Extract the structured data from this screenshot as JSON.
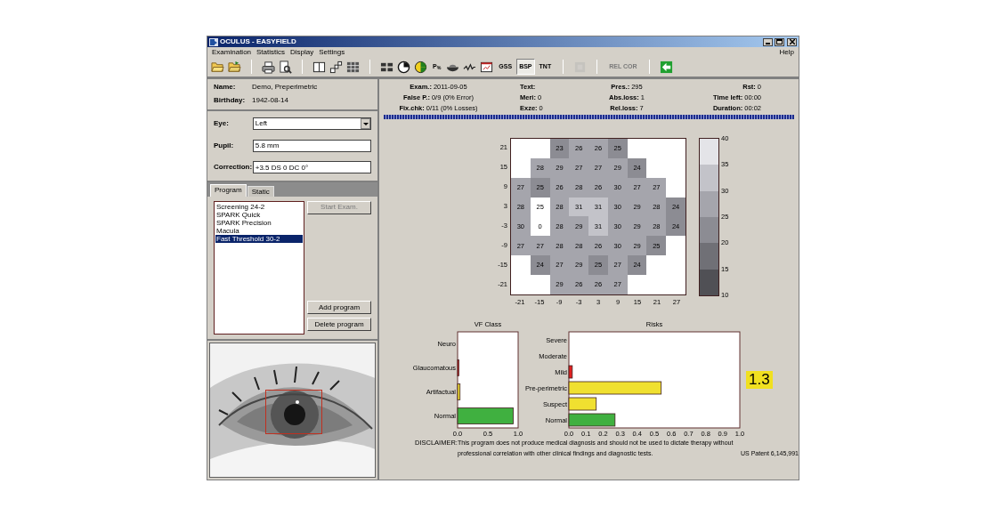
{
  "window": {
    "title": "OCULUS - EASYFIELD"
  },
  "menu": {
    "items": [
      "Examination",
      "Statistics",
      "Display",
      "Settings"
    ],
    "help": "Help"
  },
  "toolbar": [
    [
      {
        "kind": "icon",
        "disabled": false,
        "pressed": false
      },
      {
        "kind": "icon",
        "disabled": false,
        "pressed": false
      }
    ],
    [
      {
        "kind": "icon",
        "disabled": false,
        "pressed": false
      },
      {
        "kind": "icon",
        "disabled": false,
        "pressed": false
      }
    ],
    [
      {
        "kind": "icon",
        "disabled": false,
        "pressed": false
      },
      {
        "kind": "icon",
        "disabled": false,
        "pressed": false
      },
      {
        "kind": "icon",
        "disabled": false,
        "pressed": false
      }
    ],
    [
      {
        "kind": "icon",
        "disabled": false,
        "pressed": false
      },
      {
        "kind": "icon",
        "disabled": false,
        "pressed": false
      },
      {
        "kind": "icon",
        "disabled": false,
        "pressed": false
      },
      {
        "kind": "text",
        "label": "P$_{%}$",
        "disabled": false,
        "pressed": false
      },
      {
        "kind": "icon",
        "disabled": false,
        "pressed": false
      },
      {
        "kind": "icon",
        "disabled": false,
        "pressed": false
      },
      {
        "kind": "icon",
        "disabled": false,
        "pressed": false
      },
      {
        "kind": "text",
        "label": "GSS",
        "disabled": false,
        "pressed": false
      },
      {
        "kind": "text",
        "label": "BSP",
        "disabled": false,
        "pressed": true
      },
      {
        "kind": "text",
        "label": "TNT",
        "disabled": false,
        "pressed": false
      }
    ],
    [
      {
        "kind": "icon",
        "disabled": true,
        "pressed": false
      }
    ],
    [
      {
        "kind": "text",
        "label": "REL COR",
        "disabled": true,
        "pressed": false
      }
    ],
    [
      {
        "kind": "icon",
        "disabled": false,
        "pressed": false
      }
    ]
  ],
  "patient": [
    {
      "label": "Name:",
      "value": "Demo, Preperimetric"
    },
    {
      "label": "Birthday:",
      "value": "1942-08-14"
    }
  ],
  "settings": {
    "eye": {
      "label": "Eye:",
      "value": "Left"
    },
    "pupil": {
      "label": "Pupil:",
      "value": "5.8 mm"
    },
    "correction": {
      "label": "Correction:",
      "value": "+3.5 DS 0 DC 0°"
    }
  },
  "tabs": [
    {
      "label": "Program",
      "selected": true
    },
    {
      "label": "Static",
      "selected": false
    }
  ],
  "programs": [
    {
      "label": "Screening 24-2",
      "selected": false
    },
    {
      "label": "SPARK Quick",
      "selected": false
    },
    {
      "label": "SPARK Precision",
      "selected": false
    },
    {
      "label": "Macula",
      "selected": false
    },
    {
      "label": "Fast Threshold 30-2",
      "selected": true
    }
  ],
  "buttons": [
    {
      "label": "Start Exam.",
      "disabled": true
    },
    {
      "label": "Add program",
      "disabled": false
    },
    {
      "label": "Delete program",
      "disabled": false
    }
  ],
  "header": [
    [
      {
        "label": "Exam.:",
        "value": "2011-09-05"
      },
      {
        "label": "False P.:",
        "value": "0/9 (0% Error)"
      },
      {
        "label": "Fix.chk:",
        "value": "0/11 (0% Losses)"
      }
    ],
    [
      {
        "label": "Text:"
      },
      {
        "label": "Meri:",
        "value": "0"
      },
      {
        "label": "Exze:",
        "value": "0"
      }
    ],
    [
      {
        "label": "Pres.:",
        "value": "295"
      },
      {
        "label": "Abs.loss:",
        "value": "1"
      },
      {
        "label": "Rel.loss:",
        "value": "7"
      }
    ],
    [
      {
        "label": "Rst:",
        "value": "0"
      },
      {
        "label": "Time left:",
        "value": "00:00"
      },
      {
        "label": "Duration:",
        "value": "00:02"
      }
    ]
  ],
  "progress": {
    "level": 1
  },
  "threshold_map": {
    "y_labels": [
      "21",
      "15",
      "9",
      "3",
      "-3",
      "-9",
      "-15",
      "-21"
    ],
    "x_labels": [
      "-21",
      "-15",
      "-9",
      "-3",
      "3",
      "9",
      "15",
      "21",
      "27"
    ],
    "rows": [
      [
        null,
        null,
        {
          "value": "23",
          "color": "#8c8c93"
        },
        {
          "value": "26",
          "color": "#a5a5ac"
        },
        {
          "value": "26",
          "color": "#a5a5ac"
        },
        {
          "value": "25",
          "color": "#8c8c93"
        },
        null,
        null,
        null
      ],
      [
        null,
        {
          "value": "28",
          "color": "#a5a5ac"
        },
        {
          "value": "29",
          "color": "#a5a5ac"
        },
        {
          "value": "27",
          "color": "#a5a5ac"
        },
        {
          "value": "27",
          "color": "#a5a5ac"
        },
        {
          "value": "29",
          "color": "#a5a5ac"
        },
        {
          "value": "24",
          "color": "#8c8c93"
        },
        null,
        null
      ],
      [
        {
          "value": "27",
          "color": "#a5a5ac"
        },
        {
          "value": "25",
          "color": "#8c8c93"
        },
        {
          "value": "26",
          "color": "#a5a5ac"
        },
        {
          "value": "28",
          "color": "#a5a5ac"
        },
        {
          "value": "26",
          "color": "#a5a5ac"
        },
        {
          "value": "30",
          "color": "#a5a5ac"
        },
        {
          "value": "27",
          "color": "#a5a5ac"
        },
        {
          "value": "27",
          "color": "#a5a5ac"
        },
        null
      ],
      [
        {
          "value": "28",
          "color": "#a5a5ac"
        },
        {
          "value": "25",
          "color": "#ffffff"
        },
        {
          "value": "28",
          "color": "#a5a5ac"
        },
        {
          "value": "31",
          "color": "#c3c3c9"
        },
        {
          "value": "31",
          "color": "#c3c3c9"
        },
        {
          "value": "30",
          "color": "#a5a5ac"
        },
        {
          "value": "29",
          "color": "#a5a5ac"
        },
        {
          "value": "28",
          "color": "#a5a5ac"
        },
        {
          "value": "24",
          "color": "#8c8c93"
        }
      ],
      [
        {
          "value": "30",
          "color": "#a5a5ac"
        },
        {
          "value": "0",
          "color": "#ffffff"
        },
        {
          "value": "28",
          "color": "#a5a5ac"
        },
        {
          "value": "29",
          "color": "#a5a5ac"
        },
        {
          "value": "31",
          "color": "#c3c3c9"
        },
        {
          "value": "30",
          "color": "#a5a5ac"
        },
        {
          "value": "29",
          "color": "#a5a5ac"
        },
        {
          "value": "28",
          "color": "#a5a5ac"
        },
        {
          "value": "24",
          "color": "#8c8c93"
        }
      ],
      [
        {
          "value": "27",
          "color": "#a5a5ac"
        },
        {
          "value": "27",
          "color": "#a5a5ac"
        },
        {
          "value": "28",
          "color": "#a5a5ac"
        },
        {
          "value": "28",
          "color": "#a5a5ac"
        },
        {
          "value": "26",
          "color": "#a5a5ac"
        },
        {
          "value": "30",
          "color": "#a5a5ac"
        },
        {
          "value": "29",
          "color": "#a5a5ac"
        },
        {
          "value": "25",
          "color": "#8c8c93"
        },
        null
      ],
      [
        null,
        {
          "value": "24",
          "color": "#8c8c93"
        },
        {
          "value": "27",
          "color": "#a5a5ac"
        },
        {
          "value": "29",
          "color": "#a5a5ac"
        },
        {
          "value": "25",
          "color": "#8c8c93"
        },
        {
          "value": "27",
          "color": "#a5a5ac"
        },
        {
          "value": "24",
          "color": "#8c8c93"
        },
        null,
        null
      ],
      [
        null,
        null,
        {
          "value": "29",
          "color": "#a5a5ac"
        },
        {
          "value": "26",
          "color": "#a5a5ac"
        },
        {
          "value": "26",
          "color": "#a5a5ac"
        },
        {
          "value": "27",
          "color": "#a5a5ac"
        },
        null,
        null,
        null
      ]
    ]
  },
  "color_scale": {
    "ticks": [
      "40",
      "35",
      "30",
      "25",
      "20",
      "15",
      "10"
    ],
    "bands": [
      {
        "color": "#e4e4e8"
      },
      {
        "color": "#c3c3c9"
      },
      {
        "color": "#a5a5ac"
      },
      {
        "color": "#8c8c93"
      },
      {
        "color": "#707076"
      },
      {
        "color": "#505055"
      }
    ]
  },
  "vf_class": {
    "chart_data": {
      "type": "bar",
      "orientation": "horizontal",
      "title": "VF Class",
      "categories": [
        "Neuro",
        "Glaucomatous",
        "Artifactual",
        "Normal"
      ],
      "stacked": true,
      "xlim": [
        0,
        1
      ],
      "xticks": [
        {
          "value": 0,
          "label": "0.0"
        },
        {
          "value": 0.5,
          "label": "0.5"
        },
        {
          "value": 1,
          "label": "1.0"
        }
      ],
      "series": [
        {
          "color": "#e02020",
          "values": [
            null,
            0.02,
            null,
            null
          ]
        },
        {
          "color": "#f0e030",
          "values": [
            null,
            null,
            0.04,
            null
          ]
        },
        {
          "color": "#40b040",
          "values": [
            null,
            null,
            null,
            0.92
          ]
        }
      ]
    }
  },
  "risks": {
    "chart_data": {
      "type": "bar",
      "orientation": "horizontal",
      "title": "Risks",
      "categories": [
        "Severe",
        "Moderate",
        "Mild",
        "Pre-perimetric",
        "Suspect",
        "Normal"
      ],
      "stacked": true,
      "xlim": [
        0,
        1
      ],
      "xticks": [
        {
          "value": 0,
          "label": "0.0"
        },
        {
          "value": 0.1,
          "label": "0.1"
        },
        {
          "value": 0.2,
          "label": "0.2"
        },
        {
          "value": 0.3,
          "label": "0.3"
        },
        {
          "value": 0.4,
          "label": "0.4"
        },
        {
          "value": 0.5,
          "label": "0.5"
        },
        {
          "value": 0.6,
          "label": "0.6"
        },
        {
          "value": 0.7,
          "label": "0.7"
        },
        {
          "value": 0.8,
          "label": "0.8"
        },
        {
          "value": 0.9,
          "label": "0.9"
        },
        {
          "value": 1,
          "label": "1.0"
        }
      ],
      "series": [
        {
          "color": "#e02020",
          "values": [
            null,
            null,
            0.02,
            null,
            null,
            null
          ]
        },
        {
          "color": "#f0e030",
          "values": [
            null,
            null,
            null,
            0.54,
            0.16,
            null
          ]
        },
        {
          "color": "#40b040",
          "values": [
            null,
            null,
            null,
            null,
            null,
            0.27
          ]
        }
      ]
    },
    "score": "1.3"
  },
  "disclaimer": {
    "label": "DISCLAIMER:",
    "text": "This program does not produce medical diagnosis and should not be used to dictate therapy without professional correlation with other clinical findings and diagnostic tests.",
    "patent": "US Patent 6,145,991"
  }
}
